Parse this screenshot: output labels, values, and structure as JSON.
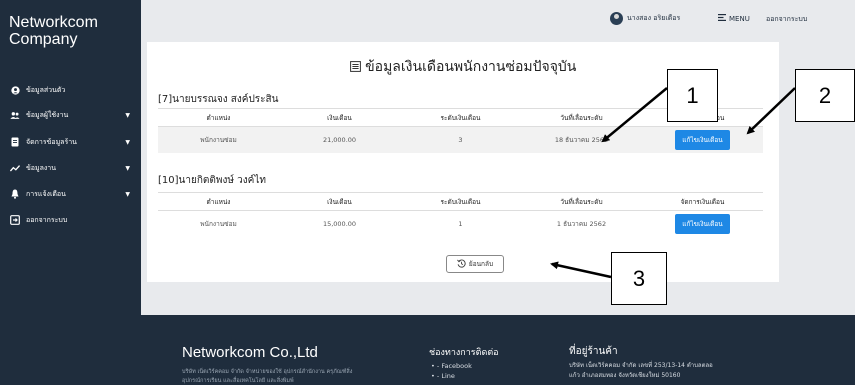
{
  "sidebar": {
    "brand_line1": "Networkcom",
    "brand_line2": "Company",
    "items": [
      {
        "label": "ข้อมูลส่วนตัว",
        "icon": "user-icon",
        "caret": false
      },
      {
        "label": "ข้อมูลผู้ใช้งาน",
        "icon": "users-icon",
        "caret": true
      },
      {
        "label": "จัดการข้อมูลร้าน",
        "icon": "store-icon",
        "caret": true
      },
      {
        "label": "ข้อมูลงาน",
        "icon": "chart-line-icon",
        "caret": true
      },
      {
        "label": "การแจ้งเตือน",
        "icon": "bell-icon",
        "caret": true
      },
      {
        "label": "ออกจากระบบ",
        "icon": "logout-icon",
        "caret": false
      }
    ]
  },
  "topbar": {
    "user_name": "นางสอง อริยเดือร",
    "menu_label": "MENU",
    "logout_label": "ออกจากระบบ"
  },
  "page": {
    "title": "ข้อมูลเงินเดือนพนักงานซ่อมปัจจุบัน"
  },
  "table_headers": [
    "ตำแหน่ง",
    "เงินเดือน",
    "ระดับเงินเดือน",
    "วันที่เลื่อนระดับ",
    "จัดการเงินเดือน"
  ],
  "employees": [
    {
      "name": "[7]นายบรรณจง สงค์ประสิน",
      "position": "พนักงานซ่อม",
      "salary": "21,000.00",
      "level": "3",
      "promotion_date": "18 ธันวาคม 2562",
      "button": "แก้ไขเงินเดือน"
    },
    {
      "name": "[10]นายกิตติพงษ์ วงค์ไท",
      "position": "พนักงานซ่อม",
      "salary": "15,000.00",
      "level": "1",
      "promotion_date": "1 ธันวาคม 2562",
      "button": "แก้ไขเงินเดือน"
    }
  ],
  "back_button": "ย้อนกลับ",
  "footer": {
    "company": "Networkcom Co.,Ltd",
    "desc": "บริษัท เน็ตเวิร์คคอม จำกัด จำหน่ายของใช้ อุปกรณ์สำนักงาน ครุภัณฑ์สิ่ง อุปกรณ์การเรียน และสื่อเทคโนโลยี และสิ่งพิมพ์",
    "contact_title": "ช่องทางการติดต่อ",
    "contact_items": [
      "- Facebook",
      "- Line"
    ],
    "address_title": "ที่อยู่ร้านค้า",
    "address_line1": "บริษัท เน็ตเวิร์คคอม จำกัด เลขที่ 253/13-14 ตำบลตลอ",
    "address_line2": "แก้ว อำเภอสมทอง จังหวัดเชียงใหม่ 50160"
  },
  "annotations": [
    "1",
    "2",
    "3"
  ]
}
